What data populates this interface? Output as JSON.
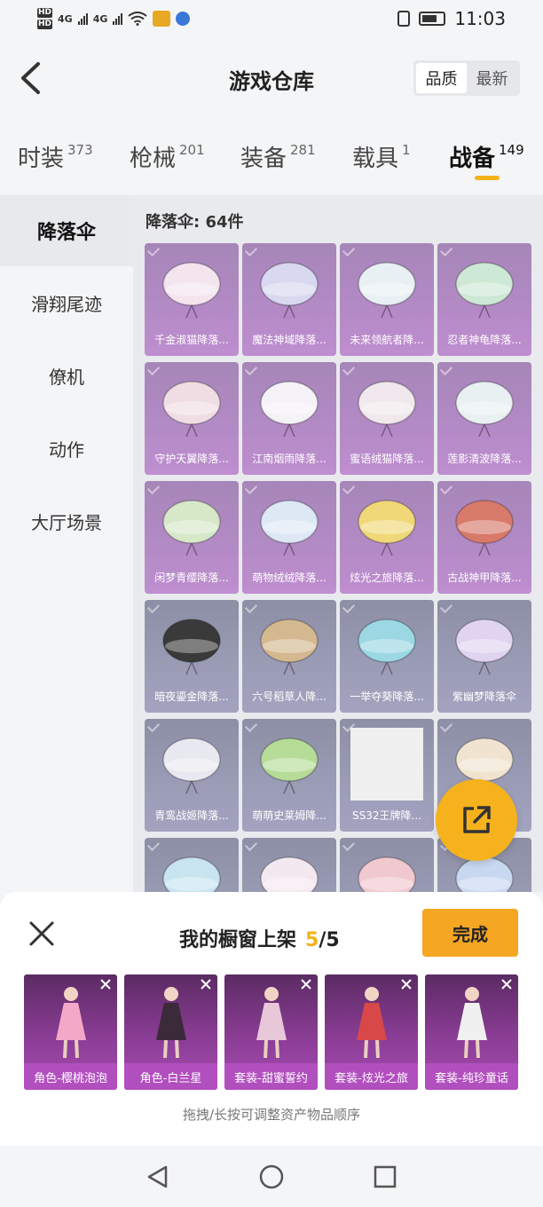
{
  "status_bar": {
    "hd_1": "HD",
    "hd_2": "HD",
    "net_1": "4G",
    "net_2": "4G",
    "time": "11:03"
  },
  "header": {
    "title": "游戏仓库",
    "sort_options": [
      "品质",
      "最新"
    ]
  },
  "categories": [
    {
      "label": "时装",
      "count": "373"
    },
    {
      "label": "枪械",
      "count": "201"
    },
    {
      "label": "装备",
      "count": "281"
    },
    {
      "label": "载具",
      "count": "1"
    },
    {
      "label": "战备",
      "count": "149"
    }
  ],
  "sidebar": {
    "items": [
      "降落伞",
      "滑翔尾迹",
      "僚机",
      "动作",
      "大厅场景"
    ]
  },
  "main": {
    "count_label": "降落伞: 64件",
    "items": [
      {
        "name": "千金淑猫降落...",
        "rarity": "purple",
        "icon": "parachute-icon"
      },
      {
        "name": "魔法神域降落...",
        "rarity": "purple",
        "icon": "parachute-icon"
      },
      {
        "name": "未来领航者降...",
        "rarity": "purple",
        "icon": "parachute-icon"
      },
      {
        "name": "忍者神龟降落...",
        "rarity": "purple",
        "icon": "parachute-icon"
      },
      {
        "name": "守护天翼降落...",
        "rarity": "purple",
        "icon": "parachute-icon"
      },
      {
        "name": "江南烟雨降落...",
        "rarity": "purple",
        "icon": "parachute-icon"
      },
      {
        "name": "蜜语绒猫降落...",
        "rarity": "purple",
        "icon": "parachute-icon"
      },
      {
        "name": "莲影清波降落...",
        "rarity": "purple",
        "icon": "parachute-icon"
      },
      {
        "name": "闲梦青缨降落...",
        "rarity": "purple",
        "icon": "parachute-icon"
      },
      {
        "name": "萌物绒绒降落...",
        "rarity": "purple",
        "icon": "parachute-icon"
      },
      {
        "name": "炫光之旅降落...",
        "rarity": "purple",
        "icon": "parachute-icon"
      },
      {
        "name": "古战神甲降落...",
        "rarity": "purple",
        "icon": "parachute-icon"
      },
      {
        "name": "暗夜鎏金降落...",
        "rarity": "blue",
        "icon": "parachute-icon"
      },
      {
        "name": "六号稻草人降...",
        "rarity": "blue",
        "icon": "parachute-icon"
      },
      {
        "name": "一举夺葵降落...",
        "rarity": "blue",
        "icon": "parachute-icon"
      },
      {
        "name": "紫幽梦降落伞",
        "rarity": "blue",
        "icon": "parachute-icon"
      },
      {
        "name": "青鸾战姬降落...",
        "rarity": "blue",
        "icon": "parachute-icon"
      },
      {
        "name": "萌萌史莱姆降...",
        "rarity": "blue",
        "icon": "parachute-icon"
      },
      {
        "name": "SS32王牌降...",
        "rarity": "blue",
        "icon": "image-placeholder-icon"
      },
      {
        "name": "",
        "rarity": "blue",
        "icon": "parachute-icon"
      },
      {
        "name": "",
        "rarity": "blue",
        "icon": "parachute-icon"
      },
      {
        "name": "",
        "rarity": "blue",
        "icon": "parachute-icon"
      },
      {
        "name": "",
        "rarity": "blue",
        "icon": "parachute-icon"
      },
      {
        "name": "",
        "rarity": "blue",
        "icon": "parachute-icon"
      }
    ]
  },
  "sheet": {
    "title": "我的橱窗上架",
    "current": "5",
    "total": "/5",
    "done_label": "完成",
    "showcase": [
      {
        "label": "角色-樱桃泡泡"
      },
      {
        "label": "角色-白兰星"
      },
      {
        "label": "套装-甜蜜誓约"
      },
      {
        "label": "套装-炫光之旅"
      },
      {
        "label": "套装-纯珍童话"
      }
    ],
    "hint": "拖拽/长按可调整资产物品顺序"
  },
  "colors": {
    "accent": "#f3b31a",
    "done_button": "#f5a623",
    "purple_card": "#b38ac5",
    "blue_card": "#9b9cb6",
    "showcase_bar": "#b24fbf"
  }
}
